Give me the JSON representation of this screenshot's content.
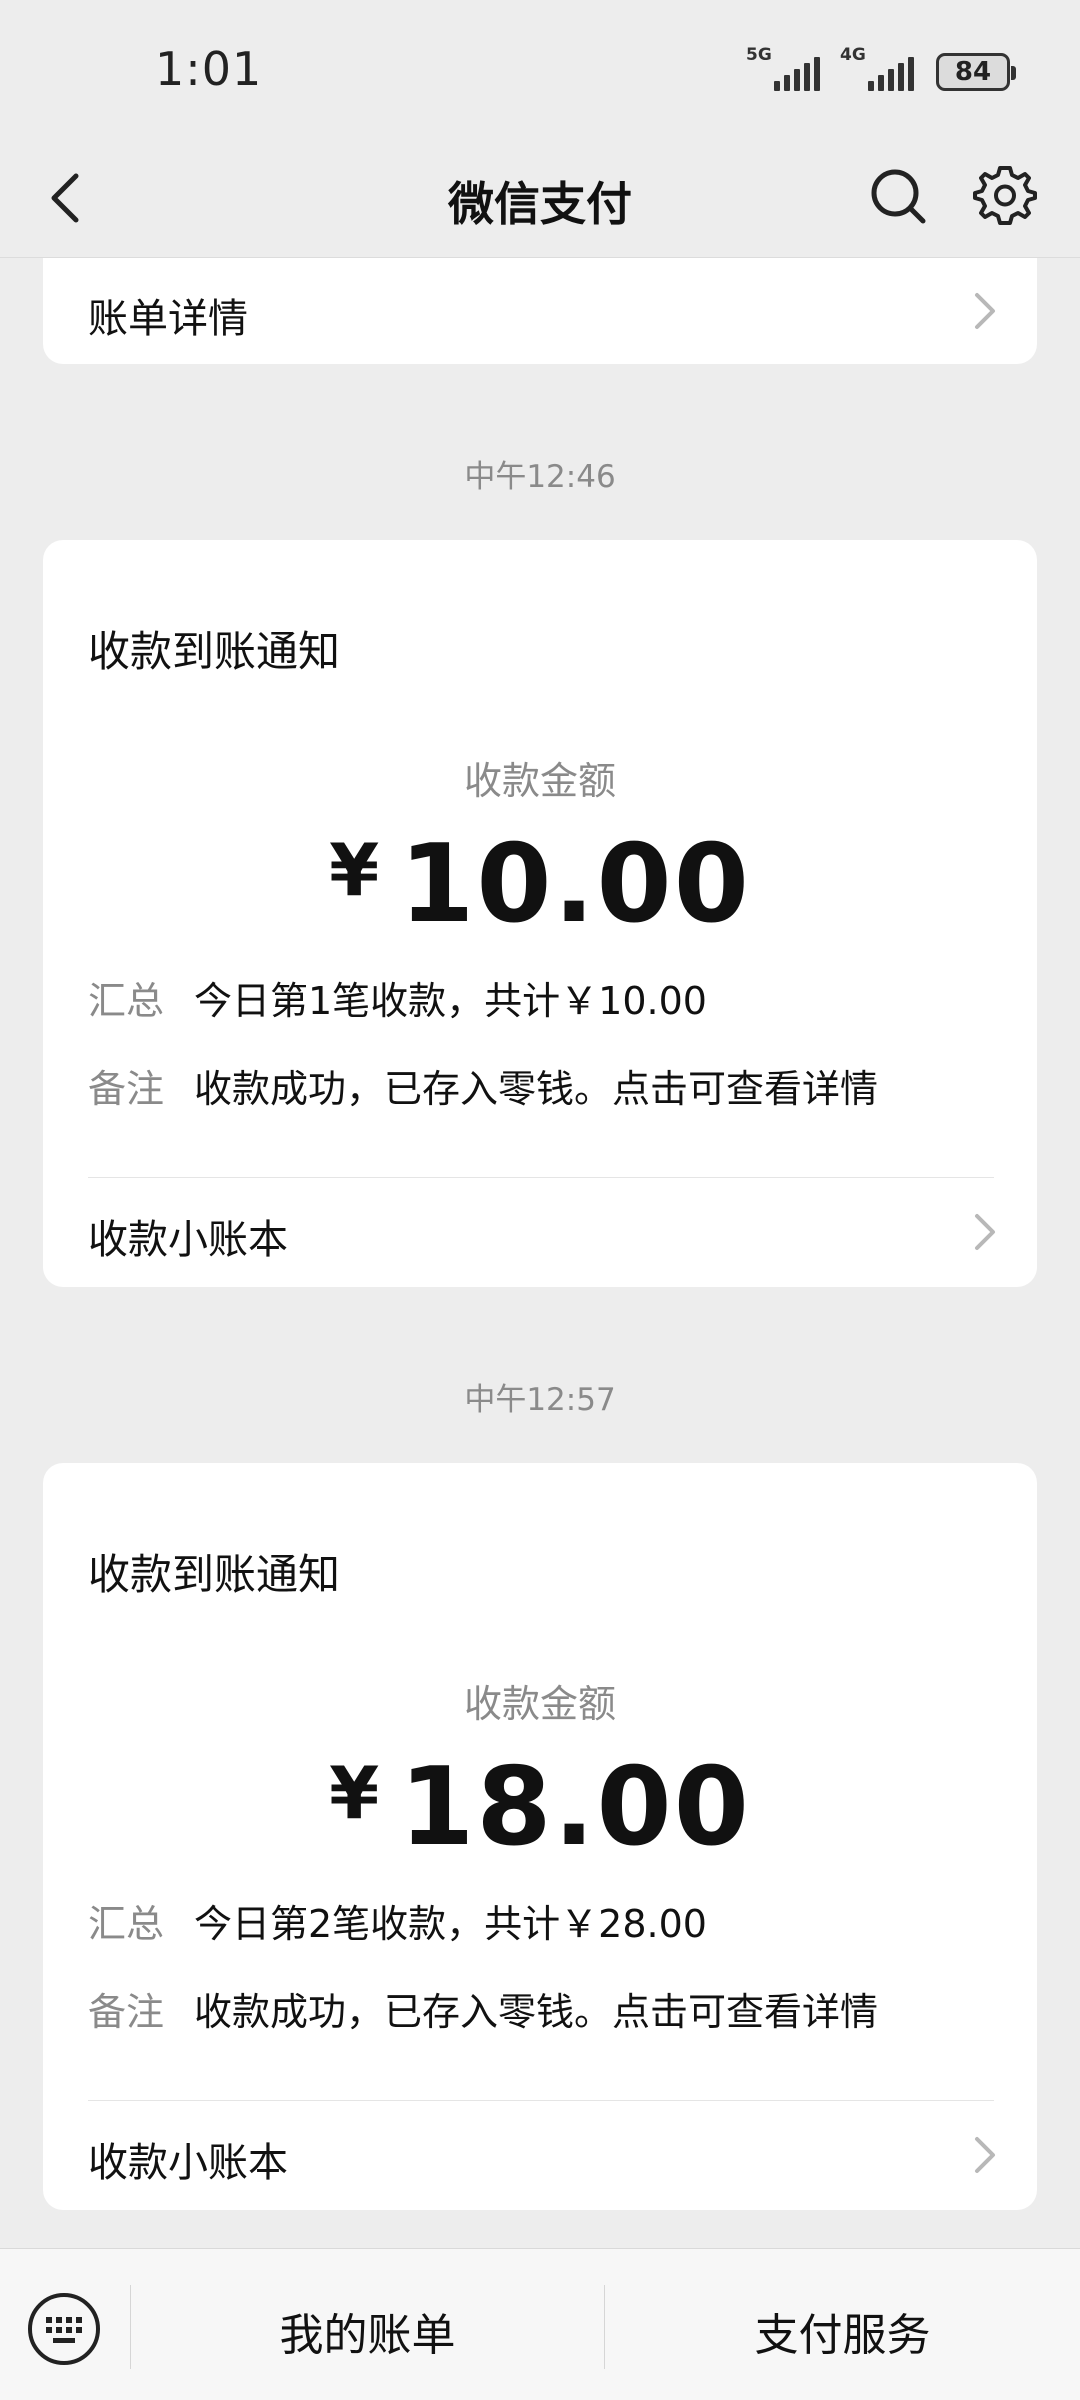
{
  "status": {
    "time": "1:01",
    "signal1": "5G",
    "signal2": "4G",
    "battery": "84"
  },
  "nav": {
    "title": "微信支付"
  },
  "bill_row": {
    "label": "账单详情"
  },
  "messages": [
    {
      "timestamp": "中午12:46",
      "title": "收款到账通知",
      "amount_label": "收款金额",
      "currency": "¥",
      "amount": "10.00",
      "summary_key": "汇总",
      "summary_val": "今日第1笔收款，共计￥10.00",
      "note_key": "备注",
      "note_val": "收款成功，已存入零钱。点击可查看详情",
      "footer": "收款小账本"
    },
    {
      "timestamp": "中午12:57",
      "title": "收款到账通知",
      "amount_label": "收款金额",
      "currency": "¥",
      "amount": "18.00",
      "summary_key": "汇总",
      "summary_val": "今日第2笔收款，共计￥28.00",
      "note_key": "备注",
      "note_val": "收款成功，已存入零钱。点击可查看详情",
      "footer": "收款小账本"
    }
  ],
  "bottom": {
    "left": "我的账单",
    "right": "支付服务"
  }
}
